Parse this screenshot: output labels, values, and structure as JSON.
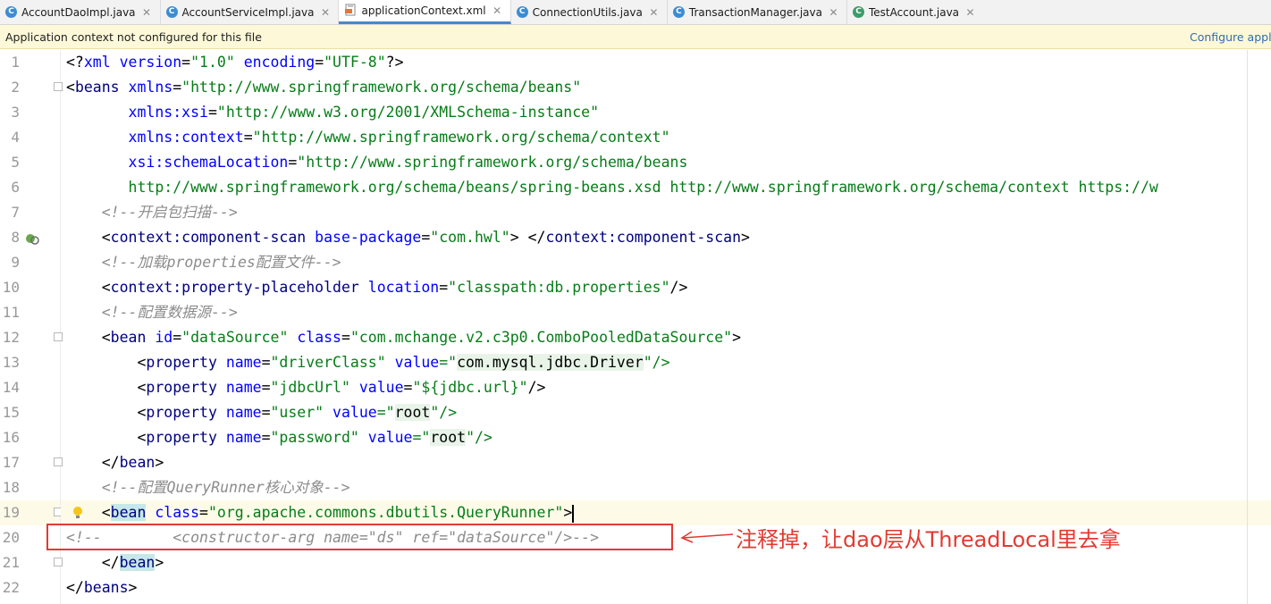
{
  "tabs": [
    {
      "label": "AccountDaoImpl.java",
      "icon": "java-class-icon",
      "icon_letter": "C"
    },
    {
      "label": "AccountServiceImpl.java",
      "icon": "java-class-icon",
      "icon_letter": "C"
    },
    {
      "label": "applicationContext.xml",
      "icon": "xml-file-icon",
      "icon_letter": "",
      "active": true
    },
    {
      "label": "ConnectionUtils.java",
      "icon": "java-class-icon",
      "icon_letter": "C"
    },
    {
      "label": "TransactionManager.java",
      "icon": "java-class-icon",
      "icon_letter": "C"
    },
    {
      "label": "TestAccount.java",
      "icon": "java-test-class-icon",
      "icon_letter": "C"
    }
  ],
  "banner": {
    "message": "Application context not configured for this file",
    "action": "Configure appli"
  },
  "lines": [
    "1",
    "2",
    "3",
    "4",
    "5",
    "6",
    "7",
    "8",
    "9",
    "10",
    "11",
    "12",
    "13",
    "14",
    "15",
    "16",
    "17",
    "18",
    "19",
    "20",
    "21",
    "22"
  ],
  "code": {
    "l1": {
      "a": "<?",
      "b": "xml",
      "c": " version",
      "d": "=",
      "e": "\"1.0\"",
      "f": " encoding",
      "g": "=",
      "h": "\"UTF-8\"",
      "i": "?>"
    },
    "l2": {
      "a": "<",
      "b": "beans",
      "c": " xmlns",
      "d": "=",
      "e": "\"http://www.springframework.org/schema/beans\""
    },
    "l3": {
      "a": "       xmlns:xsi",
      "b": "=",
      "c": "\"http://www.w3.org/2001/XMLSchema-instance\""
    },
    "l4": {
      "a": "       xmlns:context",
      "b": "=",
      "c": "\"http://www.springframework.org/schema/context\""
    },
    "l5": {
      "a": "       xsi:schemaLocation",
      "b": "=",
      "c": "\"http://www.springframework.org/schema/beans"
    },
    "l6": {
      "a": "       http://www.springframework.org/schema/beans/spring-beans.xsd http://www.springframework.org/schema/context https://w"
    },
    "l7": {
      "a": "    <!--开启包扫描-->"
    },
    "l8": {
      "a": "    <",
      "b": "context:component-scan",
      "c": " base-package",
      "d": "=",
      "e": "\"com.hwl\"",
      "f": "> </",
      "g": "context:component-scan",
      "h": ">"
    },
    "l9": {
      "a": "    <!--加载properties配置文件-->"
    },
    "l10": {
      "a": "    <",
      "b": "context:property-placeholder",
      "c": " location",
      "d": "=",
      "e": "\"classpath:db.properties\"",
      "f": "/>"
    },
    "l11": {
      "a": "    <!--配置数据源-->"
    },
    "l12": {
      "a": "    <",
      "b": "bean",
      "c": " id",
      "d": "=",
      "e": "\"dataSource\"",
      "f": " class",
      "g": "=",
      "h": "\"com.mchange.v2.c3p0.ComboPooledDataSource\"",
      "i": ">"
    },
    "l13": {
      "a": "        <",
      "b": "property",
      "c": " name",
      "d": "=",
      "e": "\"driverClass\"",
      "f": " value",
      "g": "=\"",
      "h": "com.mysql.jdbc.Driver",
      "i": "\"/>"
    },
    "l14": {
      "a": "        <",
      "b": "property",
      "c": " name",
      "d": "=",
      "e": "\"jdbcUrl\"",
      "f": " value",
      "g": "=",
      "h": "\"${jdbc.url}\"",
      "i": "/>"
    },
    "l15": {
      "a": "        <",
      "b": "property",
      "c": " name",
      "d": "=",
      "e": "\"user\"",
      "f": " value",
      "g": "=\"",
      "h": "root",
      "i": "\"/>"
    },
    "l16": {
      "a": "        <",
      "b": "property",
      "c": " name",
      "d": "=",
      "e": "\"password\"",
      "f": " value",
      "g": "=\"",
      "h": "root",
      "i": "\"/>"
    },
    "l17": {
      "a": "    </",
      "b": "bean",
      "c": ">"
    },
    "l18": {
      "a": "    <!--配置QueryRunner核心对象-->"
    },
    "l19": {
      "a": "    <",
      "b": "bean",
      "c": " class",
      "d": "=",
      "e": "\"org.apache.commons.dbutils.QueryRunner\"",
      "f": ">"
    },
    "l20": {
      "a": "<!--        <constructor-arg name=\"ds\" ref=\"dataSource\"/>-->"
    },
    "l21": {
      "a": "    </",
      "b": "bean",
      "c": ">"
    },
    "l22": {
      "a": "</",
      "b": "beans",
      "c": ">"
    }
  },
  "annotation": {
    "text": "注释掉，让dao层从ThreadLocal里去拿",
    "color": "#e23a32"
  },
  "colors": {
    "tag": "#000080",
    "attr": "#0000ff",
    "value": "#067d17",
    "comment": "#8c8c8c",
    "active_tab_underline": "#4a88c7",
    "banner_bg": "#fdf8d8"
  }
}
